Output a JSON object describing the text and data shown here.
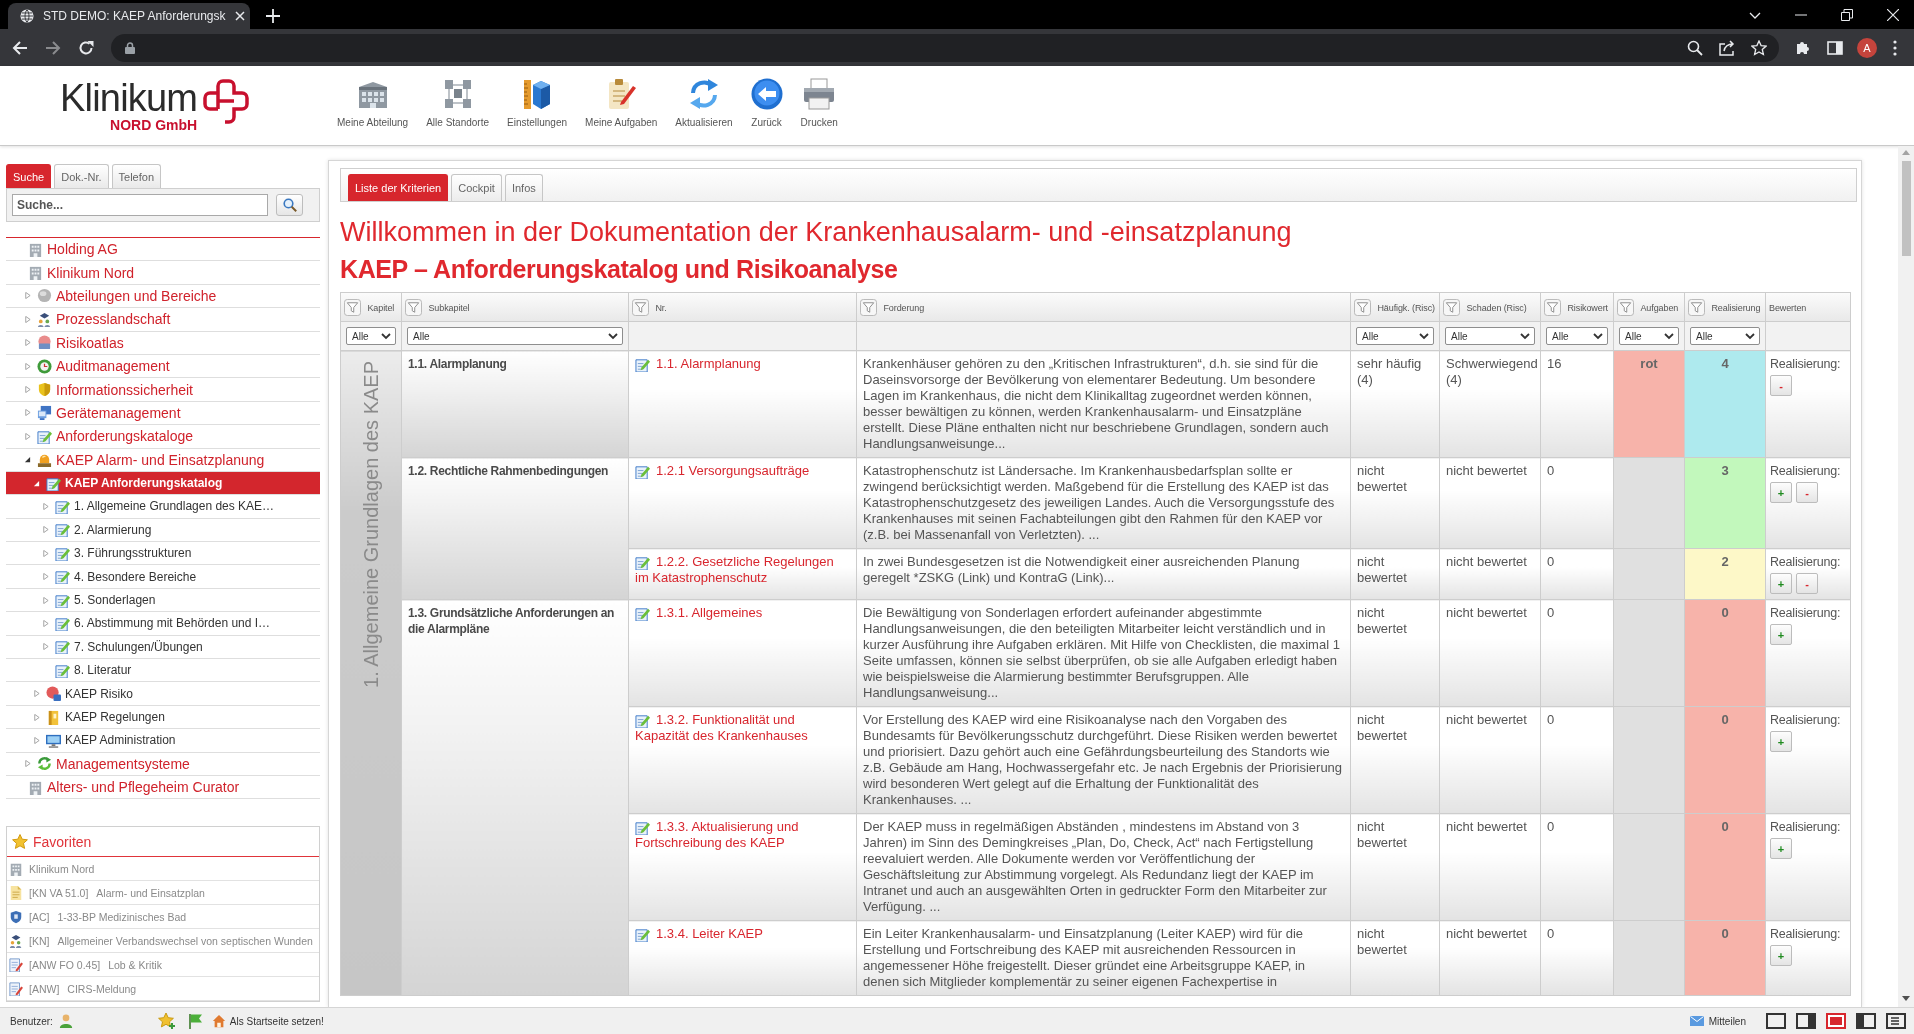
{
  "browser": {
    "tab_title": "STD DEMO: KAEP Anforderungsk",
    "avatar": "A"
  },
  "header": {
    "logo": {
      "name": "Klinikum",
      "sub": "NORD GmbH"
    },
    "toolbar": [
      {
        "label": "Meine Abteilung",
        "kind": "building"
      },
      {
        "label": "Alle Standorte",
        "kind": "sites"
      },
      {
        "label": "Einstellungen",
        "kind": "settings"
      },
      {
        "label": "Meine Aufgaben",
        "kind": "tasks"
      },
      {
        "label": "Aktualisieren",
        "kind": "refresh"
      },
      {
        "label": "Zurück",
        "kind": "back"
      },
      {
        "label": "Drucken",
        "kind": "print"
      }
    ]
  },
  "sidebar": {
    "tabs": [
      {
        "label": "Suche",
        "selected": true
      },
      {
        "label": "Dok.-Nr.",
        "selected": false
      },
      {
        "label": "Telefon",
        "selected": false
      }
    ],
    "search": {
      "placeholder": "Suche..."
    },
    "tree": [
      {
        "label": "Holding AG",
        "kind": "building",
        "selected": false
      },
      {
        "label": "Klinikum Nord",
        "kind": "building",
        "selected": false,
        "children": [
          {
            "label": "Abteilungen und Bereiche",
            "kind": "sphere",
            "expanded": false,
            "selected": false
          },
          {
            "label": "Prozesslandschaft",
            "kind": "people",
            "expanded": false,
            "selected": false
          },
          {
            "label": "Risikoatlas",
            "kind": "badge",
            "expanded": false,
            "selected": false
          },
          {
            "label": "Auditmanagement",
            "kind": "clock",
            "expanded": false,
            "selected": false
          },
          {
            "label": "Informationssicherheit",
            "kind": "shield",
            "expanded": false,
            "selected": false
          },
          {
            "label": "Gerätemanagement",
            "kind": "devices",
            "expanded": false,
            "selected": false
          },
          {
            "label": "Anforderungskataloge",
            "kind": "notepad",
            "expanded": false,
            "selected": false
          },
          {
            "label": "KAEP Alarm- und Einsatzplanung",
            "kind": "beacon",
            "expanded": true,
            "selected": false,
            "children": [
              {
                "label": "KAEP Anforderungskatalog",
                "kind": "notepad",
                "expanded": true,
                "selected": true,
                "children": [
                  {
                    "label": "1. Allgemeine Grundlagen des KAE…",
                    "kind": "notepad",
                    "expanded": false,
                    "selected": false
                  },
                  {
                    "label": "2. Alarmierung",
                    "kind": "notepad",
                    "expanded": false,
                    "selected": false
                  },
                  {
                    "label": "3. Führungsstrukturen",
                    "kind": "notepad",
                    "expanded": false,
                    "selected": false
                  },
                  {
                    "label": "4. Besondere Bereiche",
                    "kind": "notepad",
                    "expanded": false,
                    "selected": false
                  },
                  {
                    "label": "5. Sonderlagen",
                    "kind": "notepad",
                    "expanded": false,
                    "selected": false
                  },
                  {
                    "label": "6. Abstimmung mit Behörden und I…",
                    "kind": "notepad",
                    "expanded": false,
                    "selected": false
                  },
                  {
                    "label": "7. Schulungen/Übungen",
                    "kind": "notepad",
                    "expanded": false,
                    "selected": false
                  },
                  {
                    "label": "8. Literatur",
                    "kind": "notepad",
                    "selected": false
                  }
                ]
              },
              {
                "label": "KAEP Risiko",
                "kind": "riskball",
                "expanded": false,
                "selected": false
              },
              {
                "label": "KAEP Regelungen",
                "kind": "binder",
                "expanded": false,
                "selected": false
              },
              {
                "label": "KAEP Administration",
                "kind": "monitor",
                "expanded": false,
                "selected": false
              }
            ]
          },
          {
            "label": "Managementsysteme",
            "kind": "cycle",
            "expanded": false,
            "selected": false
          }
        ]
      },
      {
        "label": "Alters- und Pflegeheim Curator",
        "kind": "building",
        "selected": false
      }
    ],
    "favorites": {
      "title": "Favoriten",
      "items": [
        {
          "title": "Klinikum Nord",
          "kind": "building"
        },
        {
          "code": "[KN VA 51.0]",
          "title": "Alarm- und Einsatzplan",
          "kind": "document"
        },
        {
          "code": "[AC]",
          "title": "1-33-BP Medizinisches Bad",
          "kind": "seal"
        },
        {
          "code": "[KN]",
          "title": "Allgemeiner Verbandswechsel von septischen Wunden",
          "kind": "people"
        },
        {
          "code": "[ANW FO 0.45]",
          "title": "Lob & Kritik",
          "kind": "form"
        },
        {
          "code": "[ANW]",
          "title": "CIRS-Meldung",
          "kind": "form"
        }
      ]
    }
  },
  "main": {
    "tabs": [
      {
        "label": "Liste der Kriterien",
        "selected": true
      },
      {
        "label": "Cockpit",
        "selected": false
      },
      {
        "label": "Infos",
        "selected": false
      }
    ],
    "title": "Willkommen in der Dokumentation der Krankenhausalarm- und -einsatzplanung",
    "subtitle": "KAEP – Anforderungskatalog und Risikoanalyse",
    "table": {
      "columns": [
        {
          "label": "Kapitel",
          "filter_icon": true,
          "filter_value": "Alle"
        },
        {
          "label": "Subkapitel",
          "filter_icon": true,
          "filter_value": "Alle"
        },
        {
          "label": "Nr.",
          "filter_icon": true
        },
        {
          "label": "Forderung",
          "filter_icon": true
        },
        {
          "label": "Häufigk. (Risc)",
          "filter_icon": true,
          "filter_value": "Alle"
        },
        {
          "label": "Schaden (Risc)",
          "filter_icon": true,
          "filter_value": "Alle"
        },
        {
          "label": "Risikowert",
          "filter_icon": true,
          "filter_value": "Alle"
        },
        {
          "label": "Aufgaben",
          "filter_icon": true,
          "filter_value": "Alle"
        },
        {
          "label": "Realisierung",
          "filter_icon": true,
          "filter_value": "Alle"
        },
        {
          "label": "Bewerten",
          "filter_icon": false
        }
      ],
      "chapters": [
        {
          "title": "1. Allgemeine Grundlagen des KAEP",
          "sections": [
            {
              "subchapter": "1.1. Alarmplanung",
              "rows": [
                {
                  "nr": "1.1. Alarmplanung",
                  "requirement": "Krankenhäuser gehören zu den „Kritischen Infrastrukturen“, d.h. sie sind für die Daseinsvorsorge der Bevölkerung von elementarer Bedeutung. Um besondere Lagen im Krankenhaus, die nicht dem Klinikalltag zugeordnet werden können, besser bewältigen zu können, werden Krankenhausalarm- und Einsatzpläne erstellt. Diese Pläne enthalten nicht nur beschriebene Grundlagen, sondern auch Handlungsanweisunge...",
                  "frequency": "sehr häufig (4)",
                  "damage": "Schwerwiegend (4)",
                  "risk_value": "16",
                  "tasks": {
                    "text": "rot",
                    "color": "#f7b3aa"
                  },
                  "realization": {
                    "text": "4",
                    "color": "#aeeaee"
                  },
                  "rating": {
                    "label": "Realisierung:",
                    "buttons": [
                      {
                        "label": "-",
                        "kind": "minus"
                      }
                    ]
                  }
                }
              ]
            },
            {
              "subchapter": "1.2. Rechtliche Rahmenbedingungen",
              "rows": [
                {
                  "nr": "1.2.1 Versorgungsaufträge",
                  "requirement": "Katastrophenschutz ist Ländersache. Im Krankenhausbedarfsplan sollte er zwingend berücksichtigt werden. Maßgebend für die Erstellung des KAEP ist das Katastrophenschutzgesetz des jeweiligen Landes. Auch die Versorgungsstufe des Krankenhauses mit seinen Fachabteilungen gibt den Rahmen für den KAEP vor (z.B. bei Massenanfall von Verletzten). ...",
                  "frequency": "nicht bewertet",
                  "damage": "nicht bewertet",
                  "risk_value": "0",
                  "tasks": {
                    "color": "#e0e0e0"
                  },
                  "realization": {
                    "text": "3",
                    "color": "#c2f8bc"
                  },
                  "rating": {
                    "label": "Realisierung:",
                    "buttons": [
                      {
                        "label": "+",
                        "kind": "plus"
                      },
                      {
                        "label": "-",
                        "kind": "minus"
                      }
                    ]
                  }
                },
                {
                  "nr": "1.2.2. Gesetzliche Regelungen im Katastrophenschutz",
                  "requirement": "In zwei Bundesgesetzen ist die Notwendigkeit einer ausreichenden Planung geregelt *ZSKG (Link) und KontraG (Link)...",
                  "frequency": "nicht bewertet",
                  "damage": "nicht bewertet",
                  "risk_value": "0",
                  "tasks": {
                    "color": "#e0e0e0"
                  },
                  "realization": {
                    "text": "2",
                    "color": "#fdf8c8"
                  },
                  "rating": {
                    "label": "Realisierung:",
                    "buttons": [
                      {
                        "label": "+",
                        "kind": "plus"
                      },
                      {
                        "label": "-",
                        "kind": "minus"
                      }
                    ]
                  }
                }
              ]
            },
            {
              "subchapter": "1.3. Grundsätzliche Anforderungen an die Alarmpläne",
              "rows": [
                {
                  "nr": "1.3.1. Allgemeines",
                  "requirement": "Die Bewältigung von Sonderlagen erfordert aufeinander abgestimmte Handlungsanweisungen, die den beteiligten Mitarbeiter leicht verständlich und in kurzer Ausführung ihre Aufgaben erklären. Mit Hilfe von Checklisten, die maximal 1 Seite umfassen, können sie selbst überprüfen, ob sie alle Aufgaben erledigt haben wie beispielsweise die Alarmierung bestimmter Berufsgruppen. Alle Handlungsanweisung...",
                  "frequency": "nicht bewertet",
                  "damage": "nicht bewertet",
                  "risk_value": "0",
                  "tasks": {
                    "color": "#e0e0e0"
                  },
                  "realization": {
                    "text": "0",
                    "color": "#f7b3aa"
                  },
                  "rating": {
                    "label": "Realisierung:",
                    "buttons": [
                      {
                        "label": "+",
                        "kind": "plus"
                      }
                    ]
                  }
                },
                {
                  "nr": "1.3.2. Funktionalität und Kapazität des Krankenhauses",
                  "requirement": "Vor Erstellung des KAEP wird eine Risikoanalyse nach den Vorgaben des Bundesamts für Bevölkerungsschutz durchgeführt. Diese Risiken werden bewertet und priorisiert. Dazu gehört auch eine Gefährdungsbeurteilung des Standorts wie z.B. Gebäude am Hang, Hochwassergefahr etc. Je nach Ergebnis der Priorisierung wird besonderen Wert gelegt auf die Erhaltung der Funktionalität des Krankenhauses. ...",
                  "frequency": "nicht bewertet",
                  "damage": "nicht bewertet",
                  "risk_value": "0",
                  "tasks": {
                    "color": "#e0e0e0"
                  },
                  "realization": {
                    "text": "0",
                    "color": "#f7b3aa"
                  },
                  "rating": {
                    "label": "Realisierung:",
                    "buttons": [
                      {
                        "label": "+",
                        "kind": "plus"
                      }
                    ]
                  }
                },
                {
                  "nr": "1.3.3. Aktualisierung und Fortschreibung des KAEP",
                  "requirement": "Der KAEP muss in regelmäßigen Abständen , mindestens im Abstand von 3 Jahren) im Sinn des Demingkreises „Plan, Do, Check, Act“ nach Fertigstellung reevaluiert werden. Alle Dokumente werden vor Veröffentlichung der Geschäftsleitung zur Abstimmung vorgelegt. Als Redundanz liegt der KAEP im Intranet und auch an ausgewählten Orten in gedruckter Form den Mitarbeiter zur Verfügung. ...",
                  "frequency": "nicht bewertet",
                  "damage": "nicht bewertet",
                  "risk_value": "0",
                  "tasks": {
                    "color": "#e0e0e0"
                  },
                  "realization": {
                    "text": "0",
                    "color": "#f7b3aa"
                  },
                  "rating": {
                    "label": "Realisierung:",
                    "buttons": [
                      {
                        "label": "+",
                        "kind": "plus"
                      }
                    ]
                  }
                },
                {
                  "nr": "1.3.4. Leiter KAEP",
                  "requirement": "Ein Leiter Krankenhausalarm- und Einsatzplanung (Leiter KAEP) wird für die Erstellung und Fortschreibung des KAEP mit ausreichenden Ressourcen in angemessener Höhe freigestellt. Dieser gründet eine Arbeitsgruppe KAEP, in denen sich Mitglieder komplementär zu seiner eigenen Fachexpertise in",
                  "frequency": "nicht bewertet",
                  "damage": "nicht bewertet",
                  "risk_value": "0",
                  "tasks": {
                    "color": "#e0e0e0"
                  },
                  "realization": {
                    "text": "0",
                    "color": "#f7b3aa"
                  },
                  "rating": {
                    "label": "Realisierung:",
                    "buttons": [
                      {
                        "label": "+",
                        "kind": "plus"
                      }
                    ]
                  }
                }
              ]
            }
          ]
        }
      ]
    }
  },
  "status_bar": {
    "user_label": "Benutzer:",
    "home_label": "Als Startseite setzen!",
    "share_label": "Mitteilen",
    "layouts": [
      {
        "kind": "plain",
        "selected": false
      },
      {
        "kind": "right",
        "selected": false
      },
      {
        "kind": "filled",
        "selected": true
      },
      {
        "kind": "left",
        "selected": false
      },
      {
        "kind": "list",
        "selected": false
      }
    ]
  }
}
